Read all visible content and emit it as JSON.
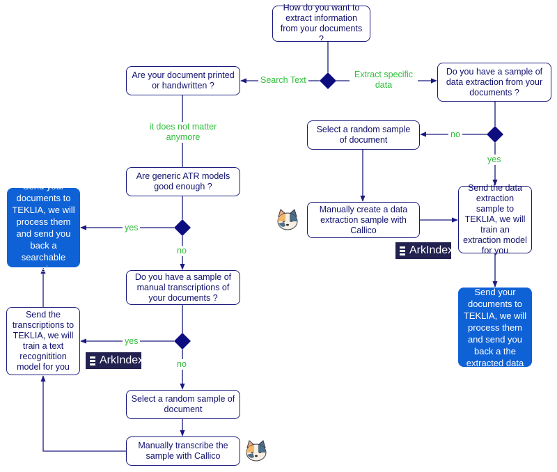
{
  "colors": {
    "node_border": "#1a1a7e",
    "node_text": "#11116e",
    "terminal_fill": "#0f62d6",
    "edge_label": "#2fbf3a",
    "decision_fill": "#0d0d80",
    "arkindex_badge": "#23214f"
  },
  "nodes": {
    "start": "How do you want to extract information from your documents ?",
    "printed_or_handwritten": "Are your document printed or handwritten ?",
    "generic_atr": "Are generic ATR models good enough ?",
    "send_searchable": "Send your documents to TEKLIA, we will process them and send you back a searchable version",
    "manual_transcriptions_sample": "Do you have a sample of manual transcriptions of your documents ?",
    "send_transcriptions": "Send the transcriptions to TEKLIA, we will train a text recognitition model for you",
    "select_sample_left": "Select a random sample of document",
    "manually_transcribe": "Manually transcribe the sample with Callico",
    "data_extraction_sample": "Do you have a sample of data extraction from your documents ?",
    "select_sample_right": "Select a random sample of document",
    "manually_create": "Manually create  a data extraction sample with Callico",
    "send_extraction_sample": "Send the data extraction sample to TEKLIA, we will train an extraction model for you",
    "send_extracted": "Send your documents to TEKLIA, we will process them and send you back a the extracted data"
  },
  "edge_labels": {
    "search_text": "Search Text",
    "extract_specific": "Extract specific data",
    "does_not_matter": "it does not matter anymore",
    "atr_yes": "yes",
    "atr_no": "no",
    "transcriptions_yes": "yes",
    "transcriptions_no": "no",
    "extraction_no": "no",
    "extraction_yes": "yes"
  },
  "badges": {
    "arkindex_left": "ArkIndex",
    "arkindex_right": "ArkIndex"
  },
  "icons": {
    "callico": "callico-cat-icon",
    "arkindex": "arkindex-logo-icon"
  }
}
